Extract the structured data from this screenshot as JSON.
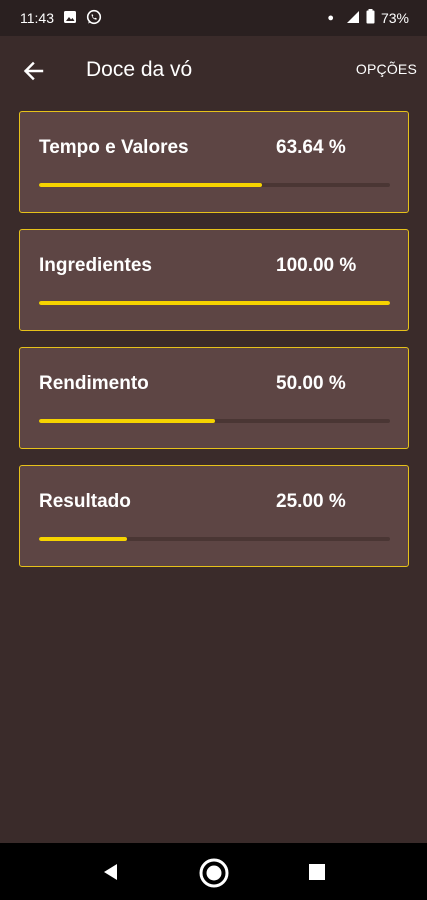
{
  "status_bar": {
    "time": "11:43",
    "icons_left": [
      "gallery-icon",
      "whatsapp-icon"
    ],
    "icons_right": [
      "notification-dot-icon",
      "signal-icon",
      "battery-icon"
    ],
    "battery": "73%"
  },
  "app_bar": {
    "title": "Doce da vó",
    "options_label": "OPÇÕES",
    "back_icon": "arrow-left-icon"
  },
  "colors": {
    "background": "#3a2b2a",
    "card_background": "#5d4544",
    "accent": "#e6c21a",
    "progress_fill": "#f5d300"
  },
  "cards": [
    {
      "label": "Tempo e Valores",
      "value_text": "63.64 %",
      "progress": 63.64
    },
    {
      "label": "Ingredientes",
      "value_text": "100.00 %",
      "progress": 100
    },
    {
      "label": "Rendimento",
      "value_text": "50.00 %",
      "progress": 50
    },
    {
      "label": "Resultado",
      "value_text": "25.00 %",
      "progress": 25
    }
  ],
  "nav_bar": {
    "buttons": [
      "back-triangle-icon",
      "home-circle-icon",
      "recents-square-icon"
    ]
  }
}
